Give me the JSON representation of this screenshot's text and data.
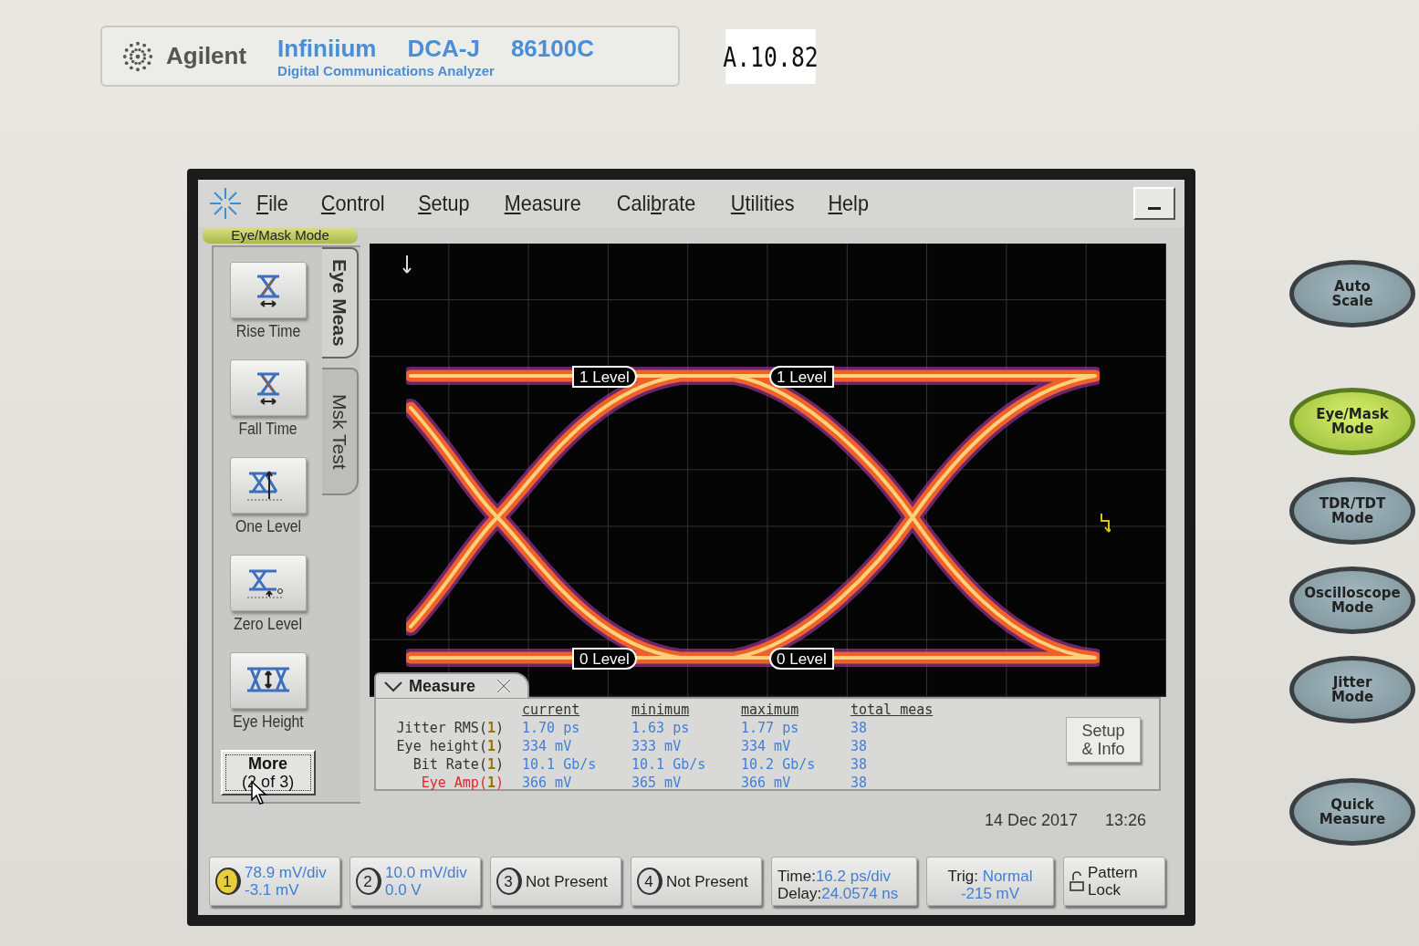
{
  "front_panel": {
    "brand": "Agilent",
    "product_line": "Infiniium",
    "model": "DCA-J",
    "model_number": "86100C",
    "subtitle": "Digital Communications Analyzer",
    "sticker": "A.10.82"
  },
  "menu": [
    {
      "key": "F",
      "post": "ile"
    },
    {
      "key": "C",
      "post": "ontrol"
    },
    {
      "key": "S",
      "post": "etup"
    },
    {
      "key": "M",
      "post": "easure"
    },
    {
      "pre": "Cali",
      "key": "b",
      "post": "rate"
    },
    {
      "key": "U",
      "post": "tilities"
    },
    {
      "key": "H",
      "post": "elp"
    }
  ],
  "mode_badge": "Eye/Mask Mode",
  "side_tabs": [
    {
      "label": "Eye Meas",
      "selected": true
    },
    {
      "label": "Msk Test",
      "selected": false
    }
  ],
  "meas_buttons": [
    {
      "label": "Rise Time",
      "kind": "rise"
    },
    {
      "label": "Fall Time",
      "kind": "fall"
    },
    {
      "label": "One Level",
      "kind": "one"
    },
    {
      "label": "Zero Level",
      "kind": "zero"
    },
    {
      "label": "Eye Height",
      "kind": "height"
    }
  ],
  "more_button": {
    "lines": [
      "More",
      "(2 of 3)"
    ]
  },
  "level_markers": [
    {
      "label": "1 Level",
      "kind": "right"
    },
    {
      "label": "1 Level",
      "kind": "left"
    },
    {
      "label": "0 Level",
      "kind": "right"
    },
    {
      "label": "0 Level",
      "kind": "left"
    }
  ],
  "measure": {
    "title": "Measure",
    "columns": [
      "current",
      "minimum",
      "maximum",
      "total meas"
    ],
    "rows": [
      {
        "name": "Jitter RMS(",
        "channel": "1",
        "close": ")",
        "highlighted": false,
        "values": [
          "1.70 ps",
          "1.63 ps",
          "1.77 ps",
          "38"
        ]
      },
      {
        "name": "Eye height(",
        "channel": "1",
        "close": ")",
        "highlighted": false,
        "values": [
          "334 mV",
          "333 mV",
          "334 mV",
          "38"
        ]
      },
      {
        "name": "Bit Rate(",
        "channel": "1",
        "close": ")",
        "highlighted": false,
        "values": [
          "10.1 Gb/s",
          "10.1 Gb/s",
          "10.2 Gb/s",
          "38"
        ]
      },
      {
        "name": "Eye Amp(",
        "channel": "1",
        "close": ")",
        "highlighted": true,
        "values": [
          "366 mV",
          "365 mV",
          "366 mV",
          "38"
        ]
      }
    ],
    "setup_button": [
      "Setup",
      "& Info"
    ]
  },
  "date": "14 Dec 2017",
  "time": "13:26",
  "status_bar": {
    "channels": [
      {
        "number": "1",
        "active": true,
        "lines": [
          "78.9 mV/div",
          "-3.1 mV"
        ]
      },
      {
        "number": "2",
        "active": false,
        "lines": [
          "10.0 mV/div",
          "0.0 V"
        ]
      },
      {
        "number": "3",
        "active": false,
        "lines": [
          "Not Present"
        ]
      },
      {
        "number": "4",
        "active": false,
        "lines": [
          "Not Present"
        ]
      }
    ],
    "timebase": {
      "time_label": "Time:",
      "time": "16.2 ps/div",
      "delay_label": "Delay:",
      "delay": "24.0574 ns"
    },
    "trigger": {
      "label": "Trig:",
      "mode": "Normal",
      "level": "-215 mV"
    },
    "pattern_lock": [
      "Pattern",
      "Lock"
    ]
  },
  "hardware_buttons": [
    {
      "lines": [
        "Auto",
        "Scale"
      ],
      "lit": false
    },
    {
      "lines": [
        "Eye/Mask",
        "Mode"
      ],
      "lit": true
    },
    {
      "lines": [
        "TDR/TDT",
        "Mode"
      ],
      "lit": false
    },
    {
      "lines": [
        "Oscilloscope",
        "Mode"
      ],
      "lit": false
    },
    {
      "lines": [
        "Jitter",
        "Mode"
      ],
      "lit": false
    },
    {
      "lines": [
        "Quick",
        "Measure"
      ],
      "lit": false
    }
  ]
}
